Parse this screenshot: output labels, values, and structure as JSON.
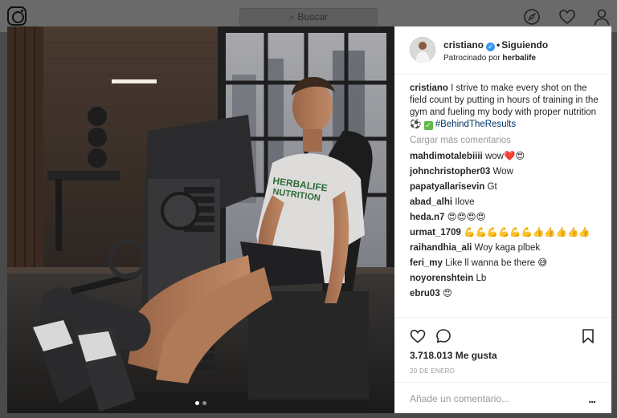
{
  "header": {
    "search_placeholder": "Buscar",
    "icons": [
      "instagram-logo",
      "compass-icon",
      "heart-icon",
      "user-icon"
    ]
  },
  "post": {
    "username": "cristiano",
    "verified": true,
    "follow_status": "Siguiendo",
    "sponsored_prefix": "Patrocinado por",
    "sponsor": "herbalife",
    "caption": {
      "username": "cristiano",
      "text": "I strive to make every shot on the field count by putting in hours of training in the gym and fueling my body with proper nutrition",
      "hashtag": "#BehindTheResults"
    },
    "load_more": "Cargar más comentarios",
    "comments": [
      {
        "user": "mahdimotalebiiii",
        "text": "wow❤️😍"
      },
      {
        "user": "johnchristopher03",
        "text": "Wow"
      },
      {
        "user": "papatyallarisevin",
        "text": "Gt"
      },
      {
        "user": "abad_alhi",
        "text": "Ilove"
      },
      {
        "user": "heda.n7",
        "text": "😍😍😍😍"
      },
      {
        "user": "urmat_1709",
        "text": "💪💪💪💪💪💪👍👍👍👍👍"
      },
      {
        "user": "raihandhia_ali",
        "text": "Woy kaga plbek"
      },
      {
        "user": "feri_my",
        "text": "Like ll wanna be there 😅"
      },
      {
        "user": "noyorenshtein",
        "text": "Lb"
      },
      {
        "user": "ebru03",
        "text": "😍"
      }
    ],
    "likes": "3.718.013 Me gusta",
    "date": "20 DE ENERO",
    "comment_placeholder": "Añade un comentario...",
    "more_label": "..."
  },
  "carousel": {
    "total": 2,
    "active_index": 0
  },
  "colors": {
    "accent": "#3897f0",
    "hashtag": "#003569",
    "muted": "#999999",
    "emoji_check": "#5fb94a"
  }
}
